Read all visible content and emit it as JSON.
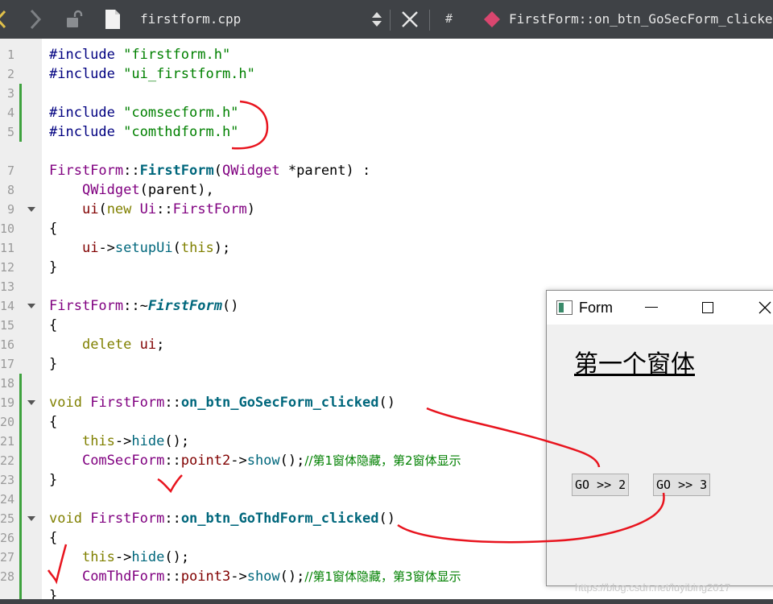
{
  "toolbar": {
    "file_name": "firstform.cpp",
    "hash": "#",
    "function": "FirstForm::on_btn_GoSecForm_clicked("
  },
  "lines": [
    {
      "n": "1"
    },
    {
      "n": "2"
    },
    {
      "n": "3"
    },
    {
      "n": "4"
    },
    {
      "n": "5"
    },
    {
      "n": "7"
    },
    {
      "n": "8"
    },
    {
      "n": "9"
    },
    {
      "n": "10"
    },
    {
      "n": "11"
    },
    {
      "n": "12"
    },
    {
      "n": "13"
    },
    {
      "n": "14"
    },
    {
      "n": "15"
    },
    {
      "n": "16"
    },
    {
      "n": "17"
    },
    {
      "n": "18"
    },
    {
      "n": "19"
    },
    {
      "n": "20"
    },
    {
      "n": "21"
    },
    {
      "n": "22"
    },
    {
      "n": "23"
    },
    {
      "n": "24"
    },
    {
      "n": "25"
    },
    {
      "n": "26"
    },
    {
      "n": "27"
    },
    {
      "n": "28"
    }
  ],
  "code": {
    "l1a": "#include ",
    "l1b": "\"firstform.h\"",
    "l2a": "#include ",
    "l2b": "\"ui_firstform.h\"",
    "l4a": "#include ",
    "l4b": "\"comsecform.h\"",
    "l5a": "#include ",
    "l5b": "\"comthdform.h\"",
    "l7a": "FirstForm",
    "l7b": "::",
    "l7c": "FirstForm",
    "l7d": "(",
    "l7e": "QWidget",
    "l7f": " *parent) :",
    "l8a": "    ",
    "l8b": "QWidget",
    "l8c": "(parent),",
    "l9a": "    ",
    "l9b": "ui",
    "l9c": "(",
    "l9d": "new",
    "l9e": " ",
    "l9f": "Ui",
    "l9g": "::",
    "l9h": "FirstForm",
    "l9i": ")",
    "l10": "{",
    "l11a": "    ",
    "l11b": "ui",
    "l11c": "->",
    "l11d": "setupUi",
    "l11e": "(",
    "l11f": "this",
    "l11g": ");",
    "l12": "}",
    "l14a": "FirstForm",
    "l14b": "::~",
    "l14c": "FirstForm",
    "l14d": "()",
    "l15": "{",
    "l16a": "    ",
    "l16b": "delete",
    "l16c": " ",
    "l16d": "ui",
    "l16e": ";",
    "l17": "}",
    "l19a": "void",
    "l19b": " ",
    "l19c": "FirstForm",
    "l19d": "::",
    "l19e": "on_btn_GoSecForm_clicked",
    "l19f": "()",
    "l20": "{",
    "l21a": "    ",
    "l21b": "this",
    "l21c": "->",
    "l21d": "hide",
    "l21e": "();",
    "l22a": "    ",
    "l22b": "ComSecForm",
    "l22c": "::",
    "l22d": "point2",
    "l22e": "->",
    "l22f": "show",
    "l22g": "();",
    "l22h": "//第1窗体隐藏，第2窗体显示",
    "l23": "}",
    "l25a": "void",
    "l25b": " ",
    "l25c": "FirstForm",
    "l25d": "::",
    "l25e": "on_btn_GoThdForm_clicked",
    "l25f": "()",
    "l26": "{",
    "l27a": "    ",
    "l27b": "this",
    "l27c": "->",
    "l27d": "hide",
    "l27e": "();",
    "l28a": "    ",
    "l28b": "ComThdForm",
    "l28c": "::",
    "l28d": "point3",
    "l28e": "->",
    "l28f": "show",
    "l28g": "();",
    "l28h": "//第1窗体隐藏，第3窗体显示",
    "l29": "}"
  },
  "form": {
    "title": "Form",
    "heading": "第一个窗体",
    "btn_go2": "GO >> 2",
    "btn_go3": "GO >> 3"
  },
  "watermark": "https://blog.csdn.net/luyibing2017",
  "colors": {
    "toolbar_bg": "#3f4246",
    "gutter_bg": "#eeeeee",
    "modified_marker": "#3ea23e",
    "annotation": "#e8141e"
  }
}
